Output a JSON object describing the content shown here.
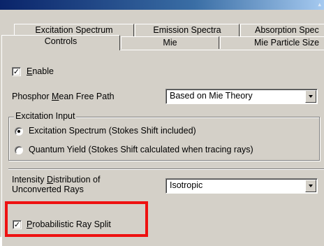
{
  "tabs_row1": [
    {
      "label": "Excitation Spectrum"
    },
    {
      "label": "Emission Spectra"
    },
    {
      "label": "Absorption Spec"
    }
  ],
  "tabs_row2": [
    {
      "label": "Controls"
    },
    {
      "label": "Mie"
    },
    {
      "label": "Mie Particle Size"
    }
  ],
  "controls": {
    "enable": {
      "mnemonic": "E",
      "rest": "nable",
      "checked": true,
      "mark": "✓"
    },
    "mean_free_path": {
      "label_pre": "Phosphor ",
      "mnemonic": "M",
      "label_post": "ean Free Path",
      "value": "Based on Mie Theory"
    },
    "excitation_input": {
      "title": "Excitation Input",
      "options": [
        {
          "label": "Excitation Spectrum (Stokes Shift included)",
          "selected": true
        },
        {
          "label": "Quantum Yield (Stokes Shift calculated when tracing rays)",
          "selected": false
        }
      ]
    },
    "intensity_distribution": {
      "line1_pre": "Intensity ",
      "mnemonic": "D",
      "line1_post": "istribution of",
      "line2": "Unconverted Rays",
      "value": "Isotropic"
    },
    "probabilistic_split": {
      "mnemonic": "P",
      "rest": "robabilistic Ray Split",
      "checked": true,
      "mark": "✓"
    }
  },
  "highlight_color": "#ee1111"
}
